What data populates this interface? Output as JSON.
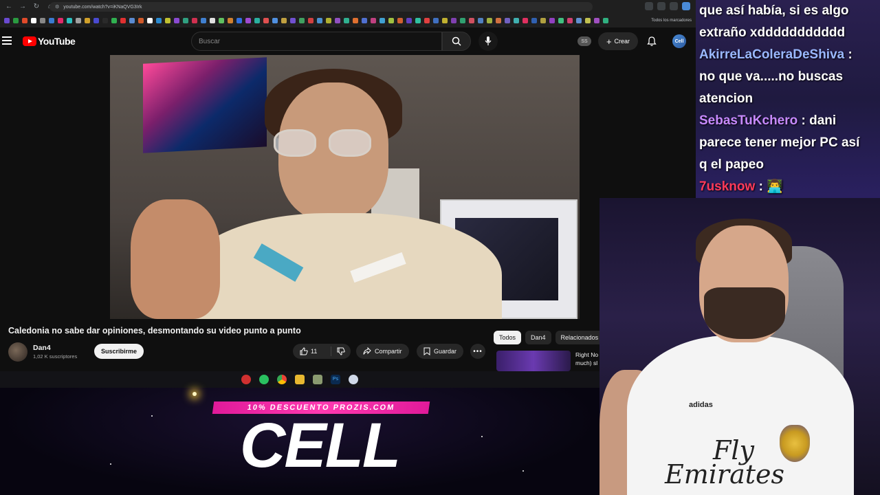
{
  "browser": {
    "url": "youtube.com/watch?v=iKNaQVG3Irk",
    "bookmarks_label": "Todos los marcadores"
  },
  "youtube": {
    "logo_text": "YouTube",
    "search_placeholder": "Buscar",
    "ss_badge": "SS",
    "create_label": "Crear",
    "avatar_label": "Cell",
    "video": {
      "title": "Caledonia no sabe dar opiniones, desmontando su video punto a punto",
      "channel": "Dan4",
      "subscribers": "1,02 K suscriptores",
      "subscribe_label": "Suscribirme",
      "likes": "11",
      "share_label": "Compartir",
      "save_label": "Guardar"
    },
    "chips": [
      "Todos",
      "Dan4",
      "Relacionados"
    ],
    "recommendation": {
      "title_line1": "Right No",
      "title_line2": "much) sl"
    }
  },
  "promo": {
    "banner": "10% DESCUENTO PROZIS.COM",
    "brand": "CELL"
  },
  "chat": {
    "messages": [
      {
        "user": "",
        "text": "que así había, si es algo"
      },
      {
        "user": "",
        "text": "extraño xddddddddddd"
      },
      {
        "user": "AkirreLaColeraDeShiva",
        "text": " :",
        "color": "#9ab8ff"
      },
      {
        "user": "",
        "text": "no que va.....no buscas"
      },
      {
        "user": "",
        "text": "atencion"
      },
      {
        "user": "SebasTuKchero",
        "text": " : dani",
        "color": "#c88aff"
      },
      {
        "user": "",
        "text": "parece tener mejor PC así"
      },
      {
        "user": "",
        "text": "q el papeo"
      },
      {
        "user": "7usknow",
        "text": " : 👨‍💻",
        "color": "#ff3a5a"
      }
    ]
  },
  "webcam": {
    "brand1": "Fly",
    "brand2": "Emirates",
    "shirt_logo": "adidas"
  }
}
